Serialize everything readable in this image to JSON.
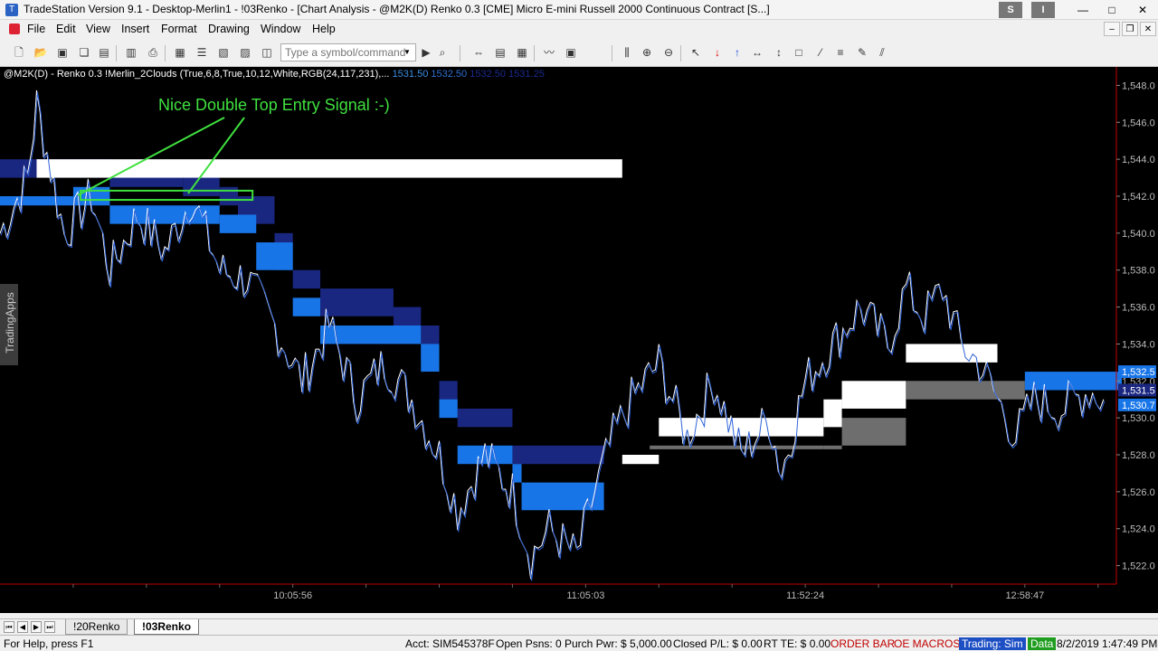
{
  "window": {
    "title": "TradeStation Version 9.1 - Desktop-Merlin1 - !03Renko - [Chart Analysis - @M2K(D) Renko 0.3 [CME] Micro E-mini Russell 2000 Continuous Contract [S...]",
    "sys_s": "S",
    "sys_i": "I",
    "minimize": "—",
    "maximize": "□",
    "close": "✕"
  },
  "menu": {
    "items": [
      "File",
      "Edit",
      "View",
      "Insert",
      "Format",
      "Drawing",
      "Window",
      "Help"
    ]
  },
  "toolbar": {
    "symbol_placeholder": "Type a symbol/command"
  },
  "chart": {
    "study_label": "@M2K(D) - Renko 0.3  !Merlin_2Clouds (True,6,8,True,10,12,White,RGB(24,117,231),...",
    "study_values": [
      "1531.50",
      "1532.50",
      "1532.50",
      "1531.25"
    ],
    "annotation": "Nice Double Top Entry Signal :-)",
    "side_tab": "TradingApps",
    "badges": [
      "1,532.5",
      "1,531.5",
      "1,530.7"
    ]
  },
  "chart_data": {
    "type": "line",
    "title": "",
    "xlabel": "",
    "ylabel": "",
    "ylim": [
      1521,
      1549
    ],
    "yticks": [
      1522,
      1524,
      1526,
      1528,
      1530,
      1532,
      1534,
      1536,
      1538,
      1540,
      1542,
      1544,
      1546,
      1548
    ],
    "ytick_labels": [
      "1,522.0",
      "1,524.0",
      "1,526.0",
      "1,528.0",
      "1,530.0",
      "1,532.0",
      "1,534.0",
      "1,536.0",
      "1,538.0",
      "1,540.0",
      "1,542.0",
      "1,544.0",
      "1,546.0",
      "1,548.0"
    ],
    "xtick_labels": [
      "10:05:56",
      "11:05:03",
      "11:52:24",
      "12:58:47"
    ],
    "xtick_bar_index": [
      160,
      320,
      440,
      560
    ],
    "bar_count": 610,
    "price_path": [
      [
        0,
        1540
      ],
      [
        15,
        1543
      ],
      [
        20,
        1547
      ],
      [
        35,
        1540
      ],
      [
        50,
        1542
      ],
      [
        60,
        1538
      ],
      [
        75,
        1541
      ],
      [
        90,
        1539
      ],
      [
        105,
        1542
      ],
      [
        120,
        1538
      ],
      [
        135,
        1537.5
      ],
      [
        150,
        1535
      ],
      [
        165,
        1532
      ],
      [
        180,
        1535
      ],
      [
        195,
        1531
      ],
      [
        210,
        1533
      ],
      [
        225,
        1531
      ],
      [
        240,
        1528
      ],
      [
        250,
        1525
      ],
      [
        265,
        1528
      ],
      [
        280,
        1526
      ],
      [
        290,
        1522.5
      ],
      [
        300,
        1524
      ],
      [
        315,
        1522.5
      ],
      [
        325,
        1526
      ],
      [
        335,
        1529
      ],
      [
        345,
        1531
      ],
      [
        360,
        1533
      ],
      [
        375,
        1529
      ],
      [
        390,
        1532
      ],
      [
        405,
        1528
      ],
      [
        420,
        1530
      ],
      [
        427,
        1527
      ],
      [
        440,
        1532
      ],
      [
        455,
        1534
      ],
      [
        470,
        1536
      ],
      [
        485,
        1534
      ],
      [
        495,
        1537
      ],
      [
        505,
        1535.5
      ],
      [
        515,
        1537
      ],
      [
        525,
        1534
      ],
      [
        535,
        1533
      ],
      [
        545,
        1531
      ],
      [
        555,
        1529
      ],
      [
        565,
        1531
      ],
      [
        580,
        1530.5
      ],
      [
        595,
        1531.5
      ],
      [
        603,
        1531
      ]
    ],
    "cloud_bands": [
      {
        "name": "",
        "color": "#1a2780",
        "segments": [
          [
            0,
            1544,
            1543
          ],
          [
            20,
            1544,
            1543
          ],
          [
            40,
            1544,
            1543
          ],
          [
            60,
            1543.5,
            1542.5
          ],
          [
            100,
            1543.5,
            1542
          ],
          [
            120,
            1542.5,
            1541.5
          ],
          [
            130,
            1542,
            1540.5
          ],
          [
            150,
            1540,
            1538
          ],
          [
            160,
            1538,
            1537
          ],
          [
            175,
            1537,
            1535.5
          ],
          [
            215,
            1536,
            1535
          ],
          [
            230,
            1535,
            1533
          ],
          [
            240,
            1532,
            1530.5
          ],
          [
            250,
            1530.5,
            1529.5
          ],
          [
            280,
            1528.5,
            1527.5
          ],
          [
            330,
            1528.5,
            1527.5
          ]
        ]
      },
      {
        "name": "",
        "color": "#1875e7",
        "segments": [
          [
            0,
            1542,
            1541.5
          ],
          [
            40,
            1542.5,
            1541.5
          ],
          [
            60,
            1541.5,
            1540.5
          ],
          [
            120,
            1541,
            1540
          ],
          [
            140,
            1539.5,
            1538
          ],
          [
            160,
            1536.5,
            1535.5
          ],
          [
            175,
            1535,
            1534
          ],
          [
            230,
            1534,
            1532.5
          ],
          [
            240,
            1531,
            1530
          ],
          [
            250,
            1528.5,
            1527.5
          ],
          [
            280,
            1527.5,
            1526.5
          ],
          [
            285,
            1526.5,
            1525
          ],
          [
            330,
            1526.5,
            1525
          ]
        ]
      },
      {
        "name": "",
        "color": "#ffffff",
        "segments": [
          [
            20,
            1544,
            1543
          ],
          [
            340,
            1528,
            1527.5
          ],
          [
            360,
            1530,
            1529
          ],
          [
            450,
            1531,
            1529.5
          ],
          [
            460,
            1532,
            1530.5
          ],
          [
            495,
            1532,
            1531
          ],
          [
            495,
            1534,
            1533
          ],
          [
            545,
            1534,
            1533
          ]
        ]
      },
      {
        "name": "",
        "color": "#6e6e6e",
        "segments": [
          [
            355,
            1528.5,
            1528.3
          ],
          [
            450,
            1528.5,
            1528.3
          ],
          [
            460,
            1530,
            1528.5
          ],
          [
            495,
            1530,
            1529
          ],
          [
            495,
            1532,
            1531
          ],
          [
            560,
            1532,
            1531
          ]
        ]
      },
      {
        "name": "",
        "color": "#1875e7",
        "segments": [
          [
            560,
            1532.5,
            1531.5
          ],
          [
            613,
            1532.5,
            1531.5
          ]
        ]
      }
    ]
  }
}
